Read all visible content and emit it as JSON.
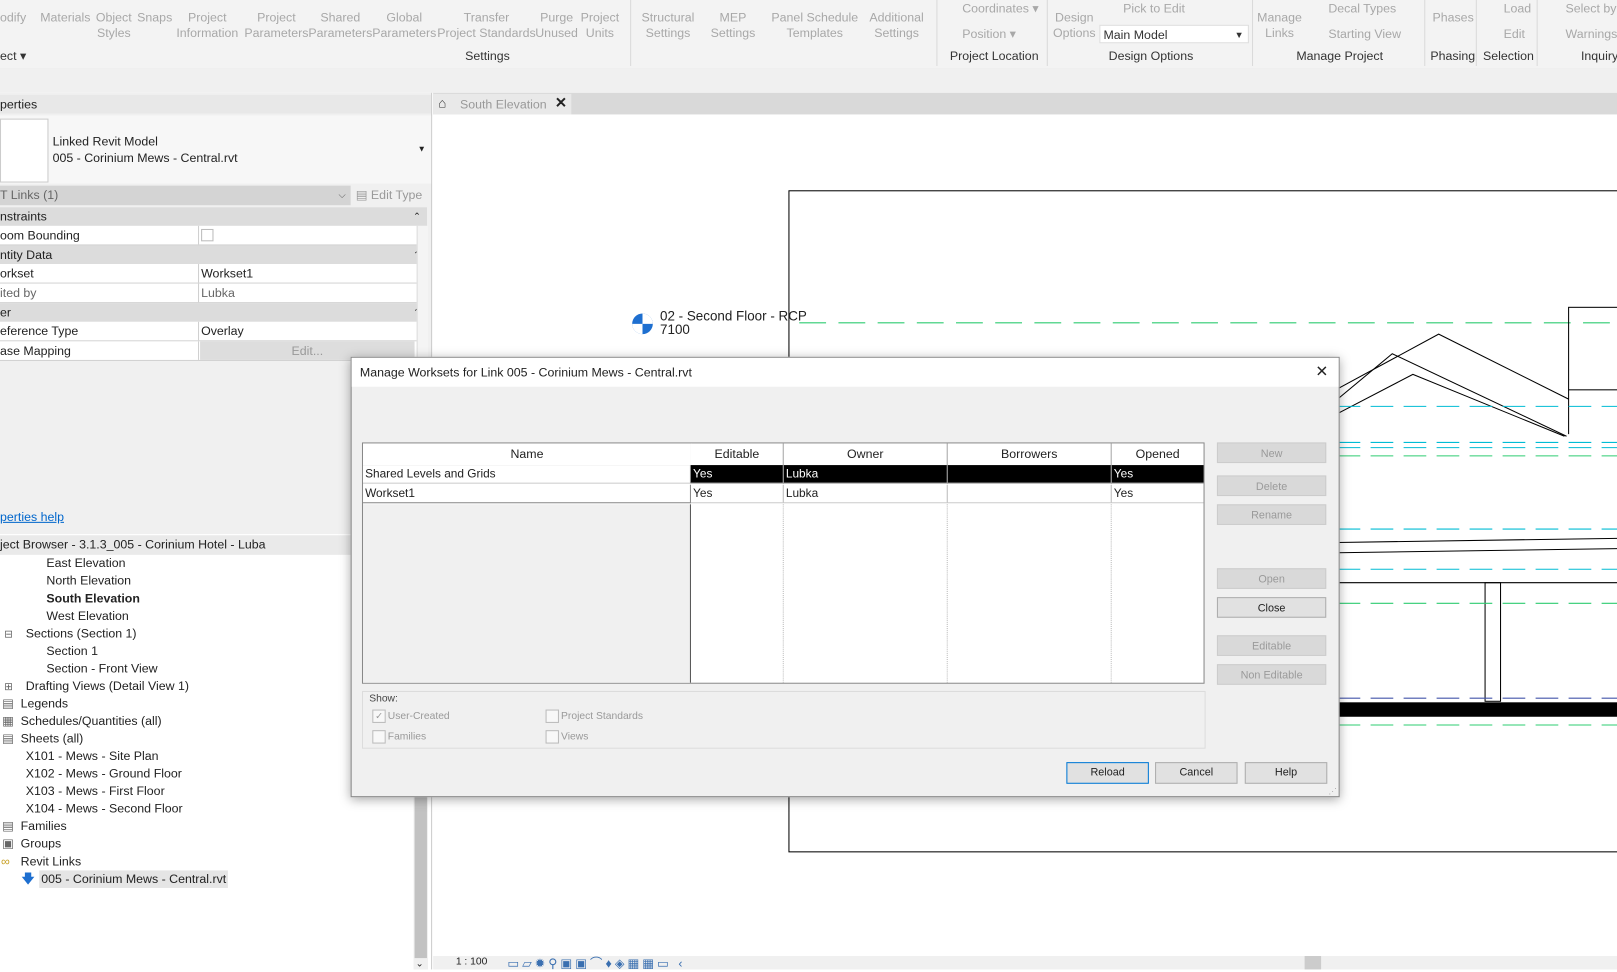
{
  "ribbon": {
    "buttons": [
      {
        "label": "odify",
        "l2": ""
      },
      {
        "label": "Materials",
        "l2": ""
      },
      {
        "label": "Object",
        "l2": "Styles"
      },
      {
        "label": "Snaps",
        "l2": ""
      },
      {
        "label": "Project",
        "l2": "Information"
      },
      {
        "label": "Project",
        "l2": "Parameters"
      },
      {
        "label": "Shared",
        "l2": "Parameters"
      },
      {
        "label": "Global",
        "l2": "Parameters"
      },
      {
        "label": "Transfer",
        "l2": "Project Standards"
      },
      {
        "label": "Purge",
        "l2": "Unused"
      },
      {
        "label": "Project",
        "l2": "Units"
      },
      {
        "label": "Structural",
        "l2": "Settings"
      },
      {
        "label": "MEP",
        "l2": "Settings"
      },
      {
        "label": "Panel Schedule",
        "l2": "Templates"
      },
      {
        "label": "Additional",
        "l2": "Settings"
      },
      {
        "label": "Coordinates ▾",
        "l2": ""
      },
      {
        "label": "Position ▾",
        "l2": ""
      },
      {
        "label": "Design",
        "l2": "Options"
      },
      {
        "label": "Pick to Edit",
        "l2": ""
      },
      {
        "label": "Manage",
        "l2": "Links"
      },
      {
        "label": "Decal  Types",
        "l2": ""
      },
      {
        "label": "Starting  View",
        "l2": ""
      },
      {
        "label": "Phases",
        "l2": ""
      },
      {
        "label": "Load",
        "l2": ""
      },
      {
        "label": "Edit",
        "l2": ""
      },
      {
        "label": "Select  by",
        "l2": ""
      },
      {
        "label": "Warnings",
        "l2": ""
      }
    ],
    "design_option_select": "Main Model",
    "groups": [
      "ect ▾",
      "Settings",
      "Project Location",
      "Design Options",
      "Manage Project",
      "Phasing",
      "Selection",
      "Inquiry"
    ]
  },
  "properties": {
    "title": "perties",
    "type_name": "Linked Revit Model",
    "type_file": "005 - Corinium Mews - Central.rvt",
    "filter": "T Links (1)",
    "edit_type": "Edit Type",
    "categories": [
      "nstraints",
      "ntity Data",
      "er"
    ],
    "rows": [
      {
        "key": "oom Bounding",
        "value": ""
      },
      {
        "key": "orkset",
        "value": "Workset1"
      },
      {
        "key": "ited by",
        "value": "Lubka"
      },
      {
        "key": "eference Type",
        "value": "Overlay"
      },
      {
        "key": "ase Mapping",
        "value": "Edit..."
      }
    ],
    "help_link": "perties help"
  },
  "browser": {
    "title": "ject Browser - 3.1.3_005 - Corinium Hotel - Luba",
    "items": [
      "East Elevation",
      "North Elevation",
      "South Elevation",
      "West Elevation",
      "Sections (Section 1)",
      "Section 1",
      "Section - Front View",
      "Drafting Views (Detail View 1)",
      "Legends",
      "Schedules/Quantities (all)",
      "Sheets (all)",
      "X101 - Mews - Site Plan",
      "X102 - Mews - Ground Floor",
      "X103 - Mews - First Floor",
      "X104 - Mews - Second Floor",
      "Families",
      "Groups",
      "Revit Links",
      "005 - Corinium Mews - Central.rvt"
    ]
  },
  "view": {
    "tab": "South Elevation",
    "level_name": "02 - Second Floor - RCP",
    "level_value": "7100",
    "scale": "1 : 100"
  },
  "dialog": {
    "title": "Manage Worksets for Link 005 - Corinium Mews - Central.rvt",
    "columns": [
      "Name",
      "Editable",
      "Owner",
      "Borrowers",
      "Opened"
    ],
    "rows": [
      [
        "Shared Levels and Grids",
        "Yes",
        "Lubka",
        "",
        "Yes"
      ],
      [
        "Workset1",
        "Yes",
        "Lubka",
        "",
        "Yes"
      ]
    ],
    "side_buttons": [
      "New",
      "Delete",
      "Rename",
      "Open",
      "Close",
      "Editable",
      "Non Editable"
    ],
    "show_label": "Show:",
    "show": [
      {
        "label": "User-Created",
        "checked": true
      },
      {
        "label": "Project Standards",
        "checked": false
      },
      {
        "label": "Families",
        "checked": false
      },
      {
        "label": "Views",
        "checked": false
      }
    ],
    "buttons": [
      "Reload",
      "Cancel",
      "Help"
    ]
  },
  "colors": {
    "accent": "#0066cc",
    "selection": "#000000",
    "level_line": "#2ecc71",
    "grid_line": "#00bcd4"
  }
}
